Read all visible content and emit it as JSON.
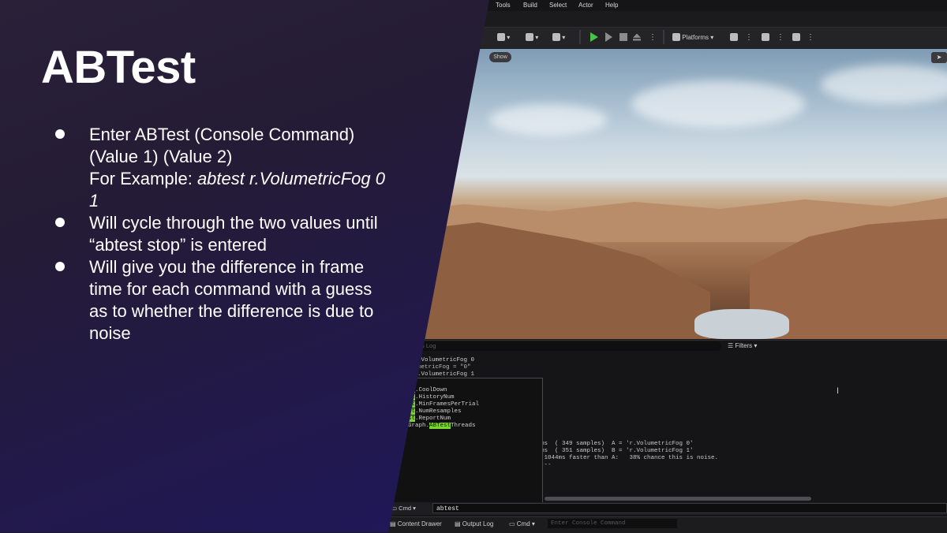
{
  "slide": {
    "title": "ABTest",
    "bullets": [
      {
        "lines": [
          "Enter ABTest (Console Command)",
          "(Value 1) (Value 2)"
        ],
        "example_prefix": "For Example: ",
        "example_code": "abtest r.VolumetricFog 0",
        "example_code_cont": "1"
      },
      {
        "lines": [
          "Will cycle through the two values until",
          "“abtest stop” is entered"
        ]
      },
      {
        "lines": [
          "Will give you the difference in frame",
          "time for each command with a guess",
          "as to whether the difference is due to",
          "noise"
        ]
      }
    ]
  },
  "editor": {
    "menu": [
      "Tools",
      "Build",
      "Select",
      "Actor",
      "Help"
    ],
    "toolbar": {
      "platforms_label": "Platforms"
    },
    "viewport": {
      "show_label": "Show"
    },
    "output_log": {
      "search_placeholder": "Search Log",
      "filters_label": "Filters",
      "lines": [
        "Cmd: r.VolumetricFog 0",
        "r.VolumetricFog = \"0\"",
        "Cmd: r.VolumetricFog 1"
      ],
      "results": [
        "ms  ( 349 samples)  A = 'r.VolumetricFog 0'",
        "ms  ( 351 samples)  B = 'r.VolumetricFog 1'",
        ".1044ms faster than A:   38% chance this is noise.",
        "---"
      ]
    },
    "autocomplete": [
      {
        "match": "abtest",
        "rest": ""
      },
      {
        "match": "abtest",
        "rest": ".CoolDown"
      },
      {
        "match": "abtest",
        "rest": ".HistoryNum"
      },
      {
        "match": "abtest",
        "rest": ".MinFramesPerTrial"
      },
      {
        "match": "abtest",
        "rest": ".NumResamples"
      },
      {
        "match": "abtest",
        "rest": ".ReportNum"
      },
      {
        "prefix": "TaskGraph.",
        "match": "ABTest",
        "rest": "Threads"
      }
    ],
    "command_bar": {
      "mode": "Cmd",
      "input_value": "abtest"
    },
    "status_bar": {
      "content_drawer": "Content Drawer",
      "output_log": "Output Log",
      "cmd": "Cmd",
      "console_placeholder": "Enter Console Command"
    },
    "highlight_color": "#7ad62b"
  }
}
